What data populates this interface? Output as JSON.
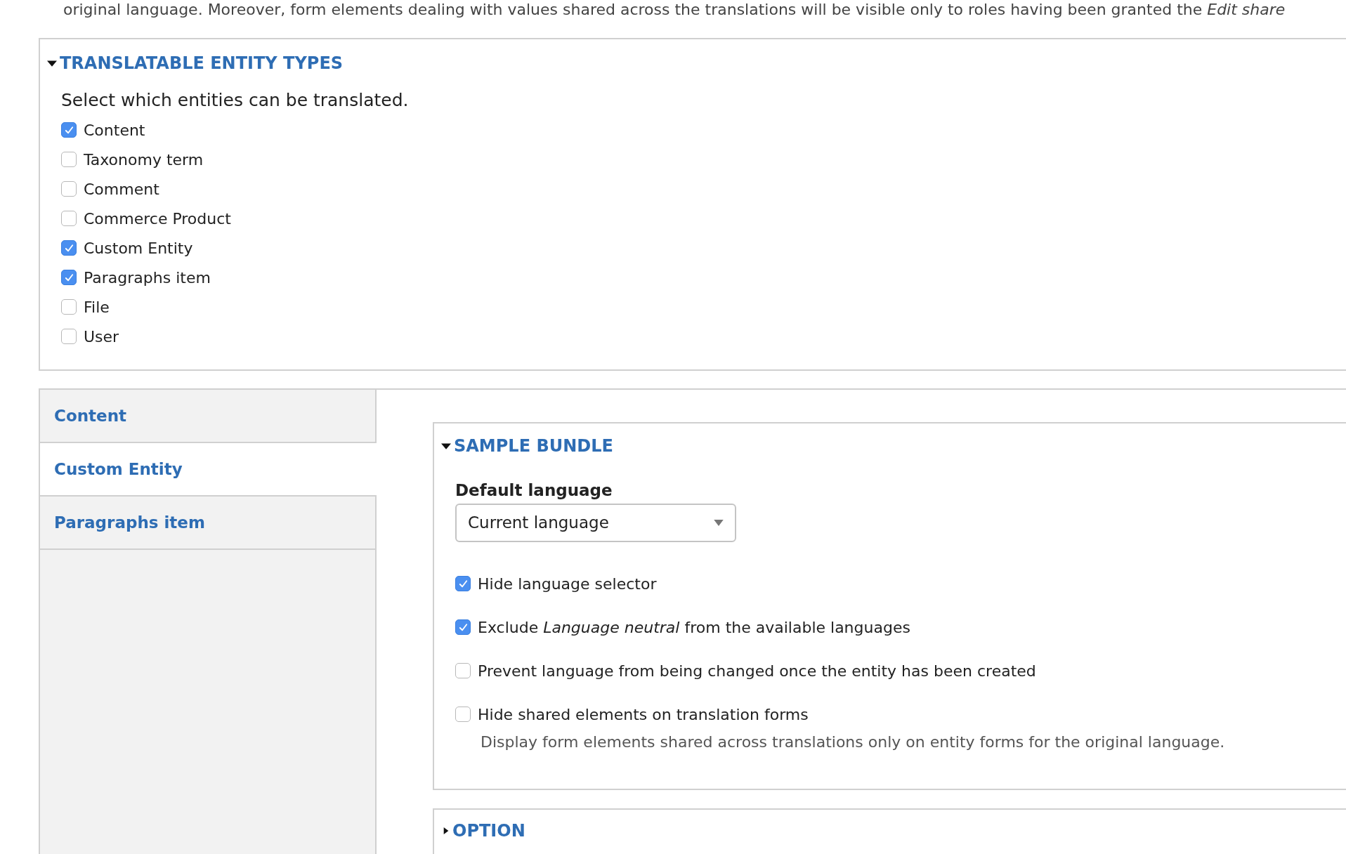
{
  "intro_text": "original language. Moreover, form elements dealing with values shared across the translations will be visible only to roles having been granted the *Edit share*",
  "entity_types": {
    "title": "TRANSLATABLE ENTITY TYPES",
    "expanded": true,
    "description": "Select which entities can be translated.",
    "options": [
      {
        "label": "Content",
        "checked": true
      },
      {
        "label": "Taxonomy term",
        "checked": false
      },
      {
        "label": "Comment",
        "checked": false
      },
      {
        "label": "Commerce Product",
        "checked": false
      },
      {
        "label": "Custom Entity",
        "checked": true
      },
      {
        "label": "Paragraphs item",
        "checked": true
      },
      {
        "label": "File",
        "checked": false
      },
      {
        "label": "User",
        "checked": false
      }
    ]
  },
  "vertical_tabs": [
    {
      "label": "Content",
      "selected": false
    },
    {
      "label": "Custom Entity",
      "selected": true
    },
    {
      "label": "Paragraphs item",
      "selected": false
    }
  ],
  "bundle": {
    "title": "SAMPLE BUNDLE",
    "expanded": true,
    "default_language": {
      "label": "Default language",
      "value": "Current language"
    },
    "options": [
      {
        "label": "Hide language selector",
        "checked": true
      },
      {
        "label": "Exclude *Language neutral* from the available languages",
        "checked": true
      },
      {
        "label": "Prevent language from being changed once the entity has been created",
        "checked": false
      },
      {
        "label": "Hide shared elements on translation forms",
        "checked": false,
        "description": "Display form elements shared across translations only on entity forms for the original language."
      }
    ]
  },
  "option_section": {
    "title": "OPTION",
    "expanded": false
  }
}
